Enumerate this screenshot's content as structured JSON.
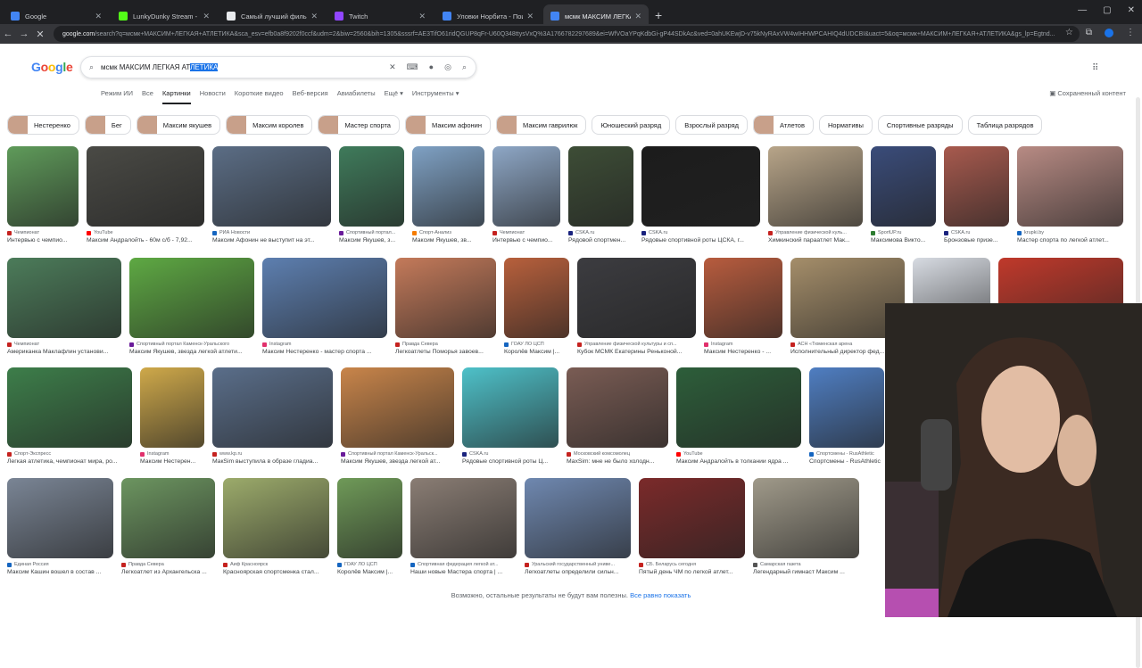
{
  "browser": {
    "tabs": [
      {
        "title": "Google",
        "color": "#4285f4"
      },
      {
        "title": "LunkyDunky Stream - Watch Li",
        "color": "#53fc18"
      },
      {
        "title": "Самый лучший фильм",
        "color": "#e8eaed"
      },
      {
        "title": "Twitch",
        "color": "#9146ff"
      },
      {
        "title": "Уловки Норбита - Поиск в Go",
        "color": "#4285f4"
      },
      {
        "title": "мсмк МАКСИМ ЛЕГКАЯ АТЛЕ",
        "color": "#4285f4"
      }
    ],
    "url_host": "google.com",
    "url_rest": "/search?q=мсмк+МАКСИМ+ЛЕГКАЯ+АТЛЕТИКА&sca_esv=efb0a8f9202f0ccf&udm=2&biw=2560&bih=1305&sssrf=AE3TifO61ridQGUP8qFr-U60Q348ttysVxQ%3A1766782297689&ei=WfVOaYPqKdbGi-gP44SDkAc&ved=0ahUKEwjD-v75kNyRAxVW4wIHHWPCAHIQ4dUDCBI&uact=5&oq=мсмк+МАКСИМ+ЛЕГКАЯ+АТЛЕТИКА&gs_lp=Egtnd..."
  },
  "google": {
    "logo": "Google",
    "query_plain": "мсмк МАКСИМ ЛЕГКАЯ АТ",
    "query_selected": "ЛЕТИКА",
    "nav_tabs": [
      "Режим ИИ",
      "Все",
      "Картинки",
      "Новости",
      "Короткие видео",
      "Веб-версия",
      "Авиабилеты",
      "Ещё ▾",
      "Инструменты ▾"
    ],
    "active_tab": "Картинки",
    "saved_content": "Сохраненный контент",
    "chips": [
      {
        "label": "Нестеренко",
        "img": true
      },
      {
        "label": "Бег",
        "img": true
      },
      {
        "label": "Максим якушев",
        "img": true
      },
      {
        "label": "Максим королев",
        "img": true
      },
      {
        "label": "Мастер спорта",
        "img": true
      },
      {
        "label": "Максим афонин",
        "img": true
      },
      {
        "label": "Максим гаврилюк",
        "img": true
      },
      {
        "label": "Юношеский разряд",
        "img": false
      },
      {
        "label": "Взрослый разряд",
        "img": false
      },
      {
        "label": "Атлетов",
        "img": true
      },
      {
        "label": "Нормативы",
        "img": false
      },
      {
        "label": "Спортивные разряды",
        "img": false
      },
      {
        "label": "Таблица разрядов",
        "img": false
      }
    ],
    "rows": [
      [
        {
          "src": "Чемпионат",
          "cap": "Интервью с чемпио...",
          "w": 80,
          "bg": "#5f9b5a",
          "icon": "#c5221f"
        },
        {
          "src": "YouTube",
          "cap": "Максим Андралойть - 60м с/б - 7,92...",
          "w": 132,
          "bg": "#4a4a45",
          "icon": "#ff0000"
        },
        {
          "src": "РИА Новости",
          "cap": "Максим Афонин не выступит на эт...",
          "w": 133,
          "bg": "#5b6d85",
          "icon": "#1565c0"
        },
        {
          "src": "Спортивный портал...",
          "cap": "Максим Якушев, з...",
          "w": 73,
          "bg": "#3f7b5b",
          "icon": "#6a1b9a"
        },
        {
          "src": "Спорт-Анализ",
          "cap": "Максим Якушев, зв...",
          "w": 81,
          "bg": "#7fa1c4",
          "icon": "#f57c00"
        },
        {
          "src": "Чемпионат",
          "cap": "Интервью с чемпио...",
          "w": 76,
          "bg": "#8ea7c6",
          "icon": "#c5221f"
        },
        {
          "src": "CSKA.ru",
          "cap": "Рядовой спортмен...",
          "w": 73,
          "bg": "#3d4d36",
          "icon": "#1a237e"
        },
        {
          "src": "CSKA.ru",
          "cap": "Рядовые спортивной роты ЦСКА, г...",
          "w": 133,
          "bg": "#1c1c1c",
          "icon": "#1a237e"
        },
        {
          "src": "Управление физической куль...",
          "cap": "Химкинский параатлет Мак...",
          "w": 106,
          "bg": "#b8a589",
          "icon": "#c5221f"
        },
        {
          "src": "SportUP.ru",
          "cap": "Максимова Викто...",
          "w": 73,
          "bg": "#3a4c7a",
          "icon": "#2e7d32"
        },
        {
          "src": "CSKA.ru",
          "cap": "Бронзовые призе...",
          "w": 73,
          "bg": "#a85a4e",
          "icon": "#1a237e"
        },
        {
          "src": "krupki.by",
          "cap": "Мастер спорта по легкой атлет...",
          "w": 119,
          "bg": "#b88b84",
          "icon": "#1565c0"
        }
      ],
      [
        {
          "src": "Чемпионат",
          "cap": "Американка Маклафлин установи...",
          "w": 128,
          "bg": "#4c7c5a",
          "icon": "#c5221f"
        },
        {
          "src": "Спортивный портал Каменск-Уральского",
          "cap": "Максим Якушев, звезда легкой атлети...",
          "w": 140,
          "bg": "#5ea943",
          "icon": "#6a1b9a"
        },
        {
          "src": "Instagram",
          "cap": "Максим Нестеренко - мастер спорта ...",
          "w": 140,
          "bg": "#5d7fb0",
          "icon": "#e1306c"
        },
        {
          "src": "Правда Севера",
          "cap": "Легкоатлеты Поморья завоев...",
          "w": 113,
          "bg": "#c47a5a",
          "icon": "#c5221f"
        },
        {
          "src": "ГОАУ ЛО ЦСП",
          "cap": "Королёв Максим |...",
          "w": 73,
          "bg": "#b8603c",
          "icon": "#1565c0"
        },
        {
          "src": "Управление физической культуры и сп...",
          "cap": "Кубок МСМК Екатерины Реньконой...",
          "w": 133,
          "bg": "#3c3c40",
          "icon": "#c5221f"
        },
        {
          "src": "Instagram",
          "cap": "Максим Нестеренко - ...",
          "w": 88,
          "bg": "#b85c3e",
          "icon": "#e1306c"
        },
        {
          "src": "АСН «Тюменская арена",
          "cap": "Исполнительный директор фед...",
          "w": 128,
          "bg": "#a58e6a",
          "icon": "#c5221f"
        },
        {
          "src": "",
          "cap": "",
          "w": 87,
          "bg": "#d7dbe2",
          "icon": "#9aa0a6"
        },
        {
          "src": "",
          "cap": "",
          "w": 140,
          "bg": "#c0392b",
          "icon": "#9aa0a6"
        }
      ],
      [
        {
          "src": "Спорт-Экспресс",
          "cap": "Легкая атлетика, чемпионат мира, ро...",
          "w": 140,
          "bg": "#3d7e4a",
          "icon": "#c5221f"
        },
        {
          "src": "Instagram",
          "cap": "Максим Нестерен...",
          "w": 72,
          "bg": "#cfa94a",
          "icon": "#e1306c"
        },
        {
          "src": "www.kp.ru",
          "cap": "MaкSim выступила в образе гладиа...",
          "w": 135,
          "bg": "#5a6e8a",
          "icon": "#c5221f"
        },
        {
          "src": "Спортивный портал Каменск-Уральск...",
          "cap": "Максим Якушев, звезда легкой ат...",
          "w": 127,
          "bg": "#c9854a",
          "icon": "#6a1b9a"
        },
        {
          "src": "CSKA.ru",
          "cap": "Рядовые спортивной роты Ц...",
          "w": 108,
          "bg": "#4ec1c9",
          "icon": "#1a237e"
        },
        {
          "src": "Московский комсомолец",
          "cap": "MaxSim: мне не было холодн...",
          "w": 114,
          "bg": "#7a5c54",
          "icon": "#c5221f"
        },
        {
          "src": "YouTube",
          "cap": "Максим Андралойть в толкании ядра ...",
          "w": 140,
          "bg": "#2d5e3a",
          "icon": "#ff0000"
        },
        {
          "src": "Спортсмены - RusAthletic",
          "cap": "Спортсмены - RusAthletic",
          "w": 84,
          "bg": "#4f7ec2",
          "icon": "#1565c0"
        }
      ],
      [
        {
          "src": "Единая Россия",
          "cap": "Максим Кашин вошел в состав ...",
          "w": 119,
          "bg": "#7a8595",
          "icon": "#1565c0"
        },
        {
          "src": "Правда Севера",
          "cap": "Легкоатлет из Архангельска ...",
          "w": 105,
          "bg": "#6c9560",
          "icon": "#c5221f"
        },
        {
          "src": "Аиф Красноярск",
          "cap": "Красноярская спортсменка стал...",
          "w": 119,
          "bg": "#9cab6b",
          "icon": "#c5221f"
        },
        {
          "src": "ГОАУ ЛО ЦСП",
          "cap": "Королёв Максим |...",
          "w": 73,
          "bg": "#6f9a58",
          "icon": "#1565c0"
        },
        {
          "src": "Спортивная федерация легкой ат...",
          "cap": "Наши новые Мастера спорта | ...",
          "w": 119,
          "bg": "#8a7d74",
          "icon": "#1565c0"
        },
        {
          "src": "Уральский государственный униве...",
          "cap": "Легкоатлеты определили сильн...",
          "w": 119,
          "bg": "#6f88b0",
          "icon": "#c5221f"
        },
        {
          "src": "СБ. Беларусь сегодня",
          "cap": "Пятый день ЧМ по легкой атлет...",
          "w": 119,
          "bg": "#7b2a2a",
          "icon": "#c5221f"
        },
        {
          "src": "Самарская газета",
          "cap": "Легендарный гимнаст Максим ...",
          "w": 119,
          "bg": "#a09a8a",
          "icon": "#555555"
        }
      ]
    ],
    "more_results": "Возможно, остальные результаты не будут вам полезны.",
    "show_anyway": "Все равно показать"
  }
}
